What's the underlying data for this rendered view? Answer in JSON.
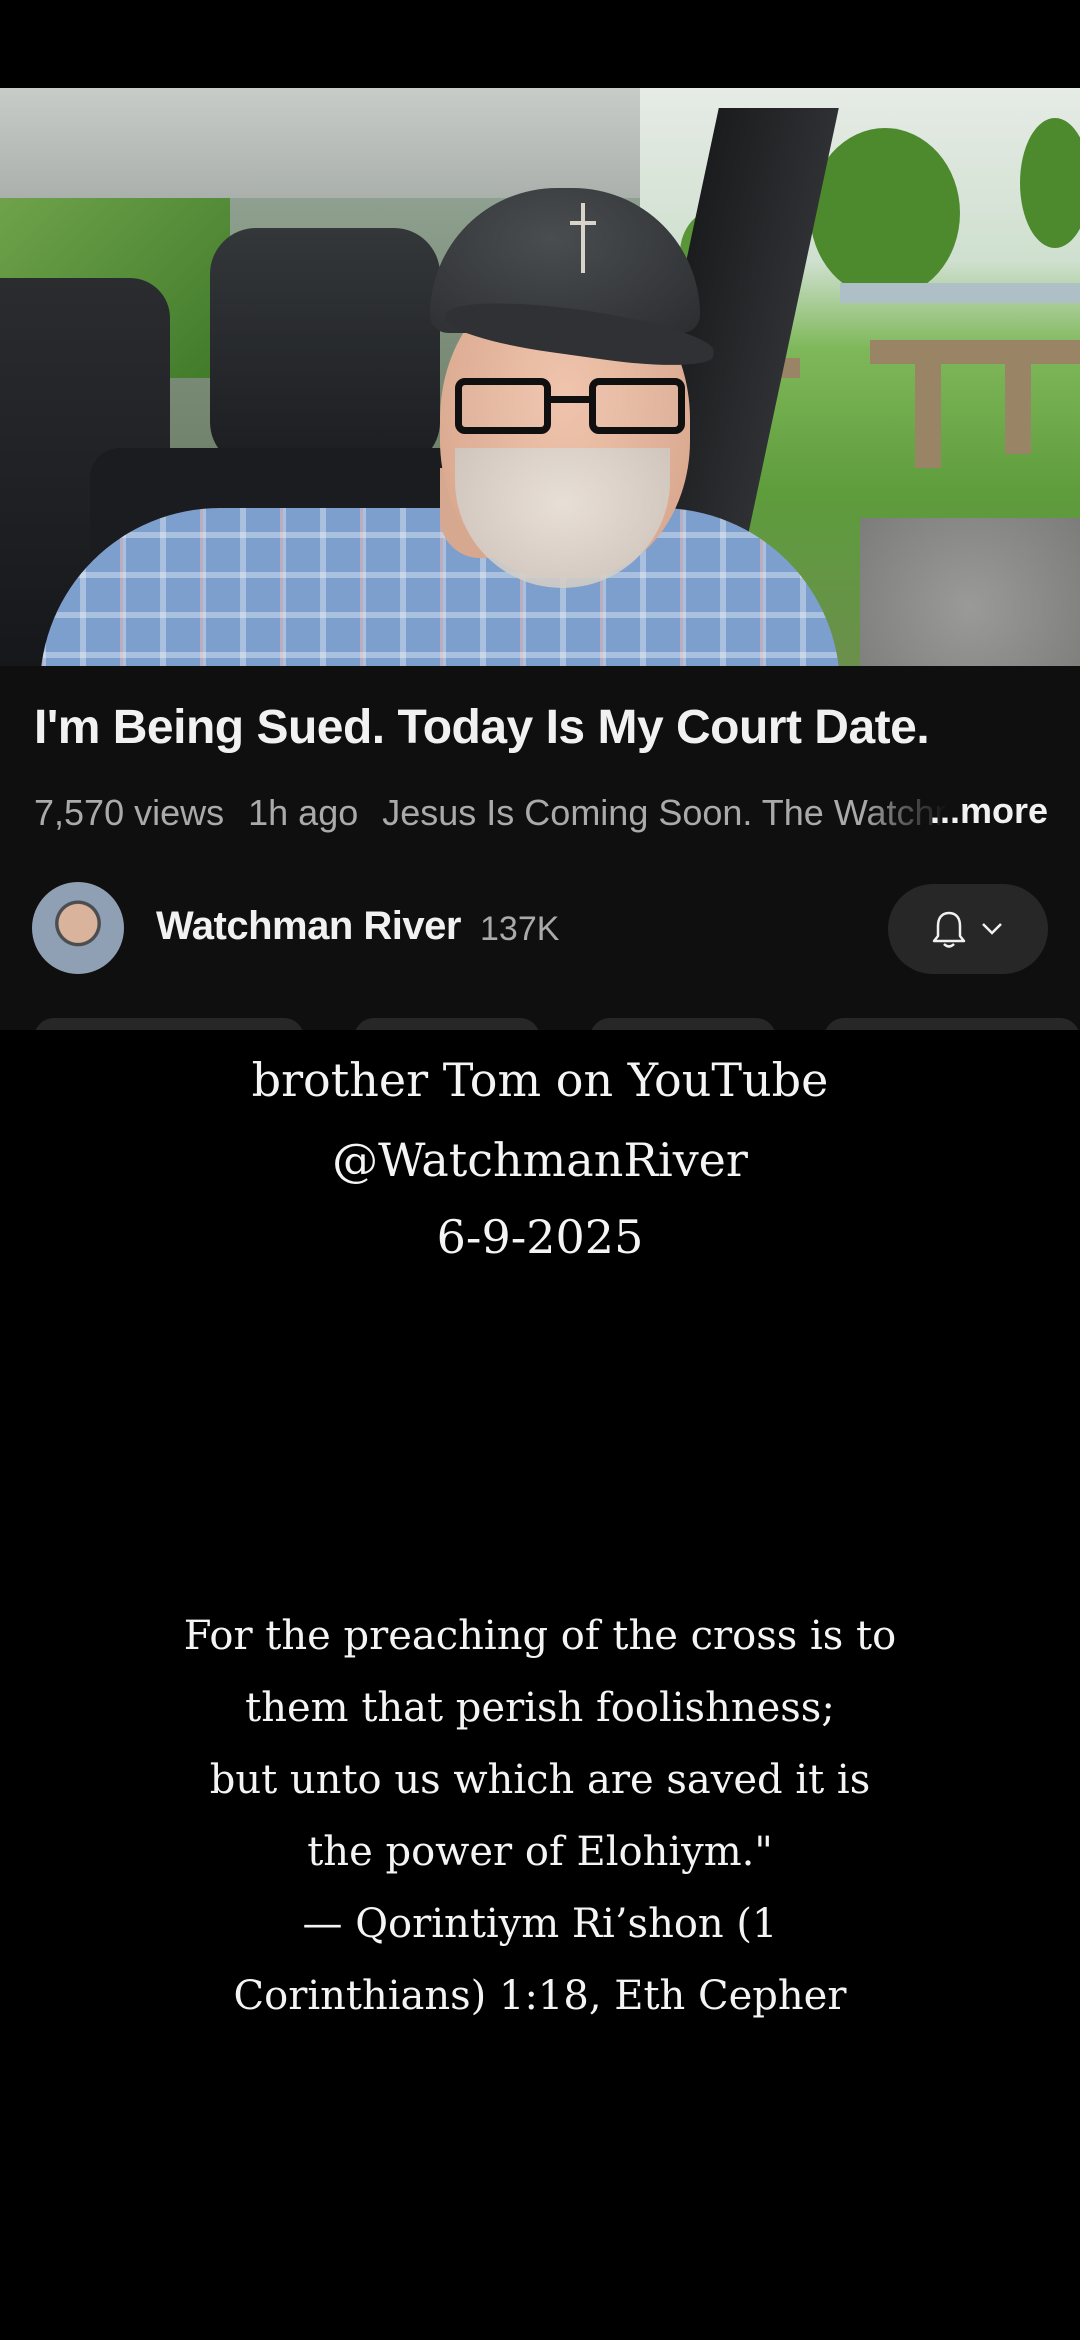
{
  "video": {
    "title": "I'm Being Sued. Today Is My Court Date.",
    "views": "7,570 views",
    "age": "1h ago",
    "description_preview": "Jesus Is Coming Soon. The Watchm",
    "more_label": "...more"
  },
  "channel": {
    "name": "Watchman River",
    "subscribers": "137K",
    "bell_icon": "bell-icon",
    "chevron_icon": "chevron-down-icon"
  },
  "caption": {
    "line1": "brother Tom on YouTube",
    "line2": "@WatchmanRiver",
    "line3": "6-9-2025"
  },
  "verse": {
    "lines": [
      "For the preaching of the cross is to",
      "them that perish foolishness;",
      "but unto us which are saved it is",
      "the power of Elohiym.\"",
      "— Qorintiym Ri’shon (1",
      "Corinthians) 1:18, Eth Cepher"
    ]
  },
  "colors": {
    "background": "#000000",
    "panel": "#0f0f0f",
    "button": "#272727",
    "secondary_text": "#aaaaaa"
  }
}
